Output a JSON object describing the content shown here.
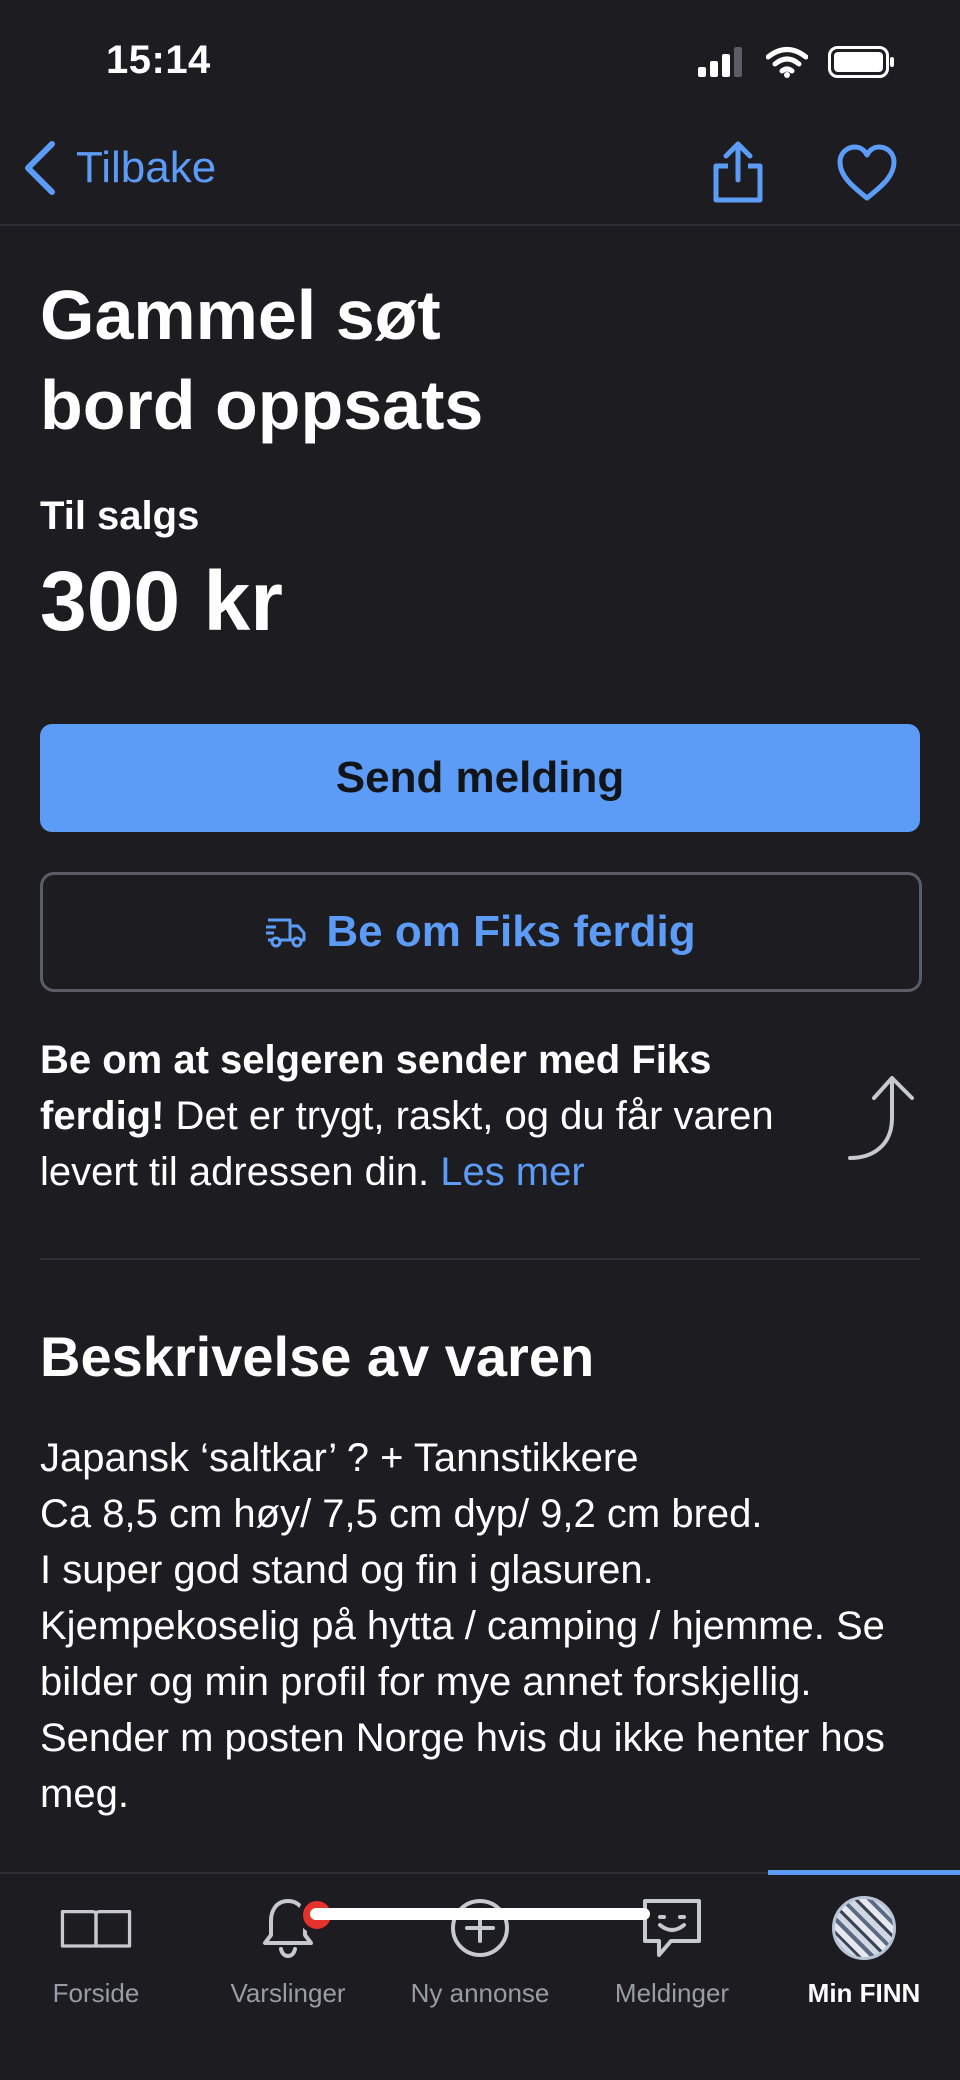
{
  "status_bar": {
    "time": "15:14"
  },
  "nav": {
    "back_label": "Tilbake",
    "back_icon": "chevron-left",
    "share_icon": "share",
    "favorite_icon": "heart"
  },
  "listing": {
    "title": "Gammel søt bord oppsats",
    "sale_type": "Til salgs",
    "price": "300 kr"
  },
  "actions": {
    "send_message": "Send melding",
    "fiks_ferdig": "Be om Fiks ferdig",
    "fiks_icon": "delivery-truck"
  },
  "fiks_info": {
    "bold": "Be om at selgeren sender med Fiks ferdig!",
    "text": " Det er trygt, raskt, og du får varen levert til adressen din. ",
    "link": "Les mer"
  },
  "description": {
    "heading": "Beskrivelse av varen",
    "body": "Japansk ‘saltkar’ ? + Tannstikkere\nCa 8,5 cm høy/ 7,5 cm dyp/ 9,2 cm bred.\nI super god stand og fin i glasuren.\nKjempekoselig på hytta / camping / hjemme. Se bilder og min profil for mye annet forskjellig. Sender m posten Norge hvis du ikke henter hos meg."
  },
  "tabs": [
    {
      "label": "Forside",
      "icon": "book"
    },
    {
      "label": "Varslinger",
      "icon": "bell",
      "badge": true
    },
    {
      "label": "Ny annonse",
      "icon": "plus-circle"
    },
    {
      "label": "Meldinger",
      "icon": "chat"
    },
    {
      "label": "Min FINN",
      "icon": "avatar",
      "active": true
    }
  ],
  "colors": {
    "background": "#1c1c21",
    "accent": "#5d9cf6",
    "badge": "#e5322b"
  }
}
